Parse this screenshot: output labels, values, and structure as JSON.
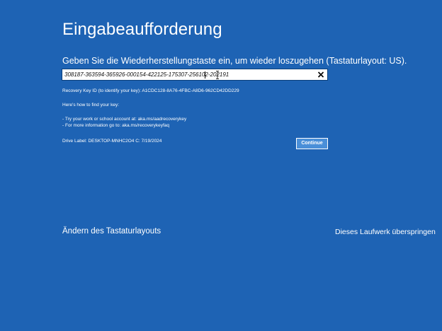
{
  "header": {
    "title": "Eingabeaufforderung"
  },
  "recovery": {
    "prompt": "Geben Sie die Wiederherstellungstaste ein, um wieder loszugehen (Tastaturlayout: US).",
    "key_value": "308187-363594-365926-000154-422125-175307-256102-202191",
    "key_id_line": "Recovery Key ID (to identify your key): A1CDC128-8A76-4FBC-A8D6-962CD42DD229",
    "how_to_find": "Here's how to find your key:",
    "hint_work_account": "- Try your work or school account at: aka.ms/aadrecoverykey",
    "hint_more_info": "- For more information go to: aka.ms/recoverykeyfaq",
    "drive_label": "Drive Label: DESKTOP-MNHC2O4 C: 7/19/2024",
    "continue_label": "Continue"
  },
  "footer": {
    "change_keyboard_label": "Ändern des Tastaturlayouts",
    "skip_drive_label": "Dieses Laufwerk überspringen"
  },
  "icons": {
    "clear": "close-icon",
    "cursor": "ibeam-cursor-icon"
  },
  "colors": {
    "background": "#1e63b4",
    "text": "#ffffff",
    "input_background": "#ffffff",
    "button_background": "#4a8fd8"
  }
}
